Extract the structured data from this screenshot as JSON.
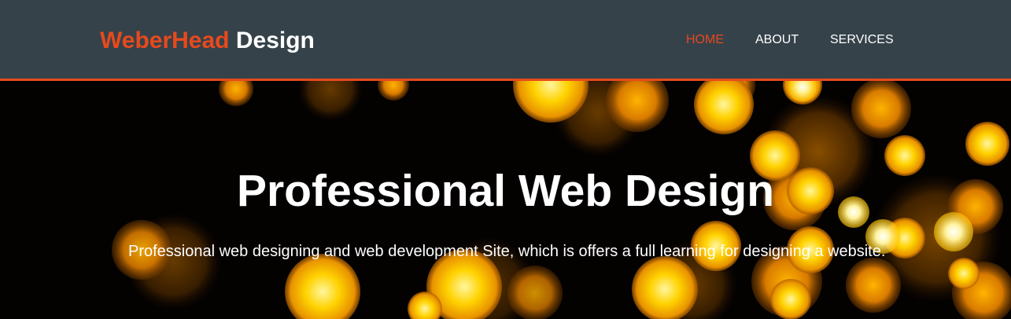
{
  "branding": {
    "highlight": "WeberHead",
    "rest": " Design"
  },
  "nav": {
    "items": [
      {
        "label": "HOME",
        "current": true
      },
      {
        "label": "ABOUT",
        "current": false
      },
      {
        "label": "SERVICES",
        "current": false
      }
    ]
  },
  "showcase": {
    "heading": "Professional Web Design",
    "tagline": "Professional web designing and web development Site, which is offers a full learning for designing a website."
  },
  "colors": {
    "header_bg": "#35424a",
    "accent": "#e8491d",
    "text": "#ffffff"
  }
}
